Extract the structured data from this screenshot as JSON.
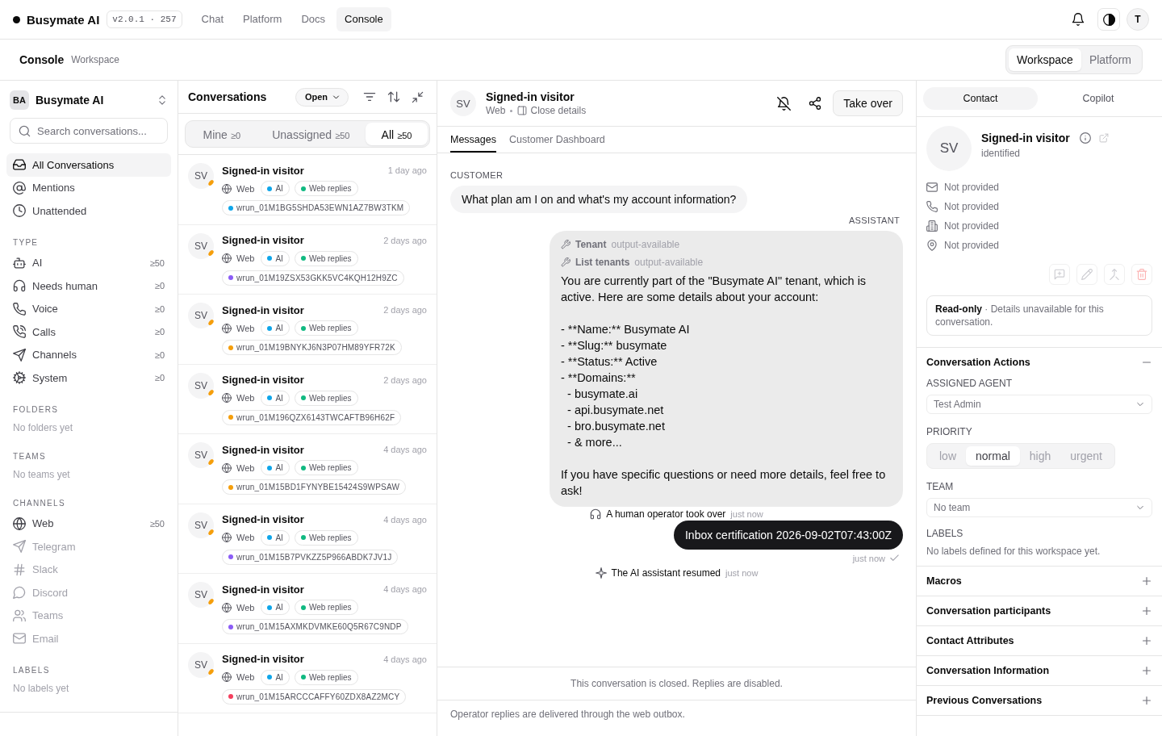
{
  "topbar": {
    "brand": "Busymate AI",
    "version": "v2.0.1 · 257",
    "nav": [
      {
        "label": "Chat",
        "selected": false
      },
      {
        "label": "Platform",
        "selected": false
      },
      {
        "label": "Docs",
        "selected": false
      },
      {
        "label": "Console",
        "selected": true
      }
    ],
    "avatar": "T"
  },
  "subheader": {
    "title": "Console",
    "subtitle": "Workspace",
    "scopes": [
      {
        "label": "Workspace",
        "selected": true
      },
      {
        "label": "Platform",
        "selected": false
      }
    ]
  },
  "sidebar": {
    "workspace": {
      "initials": "BA",
      "name": "Busymate AI"
    },
    "search": {
      "placeholder": "Search conversations..."
    },
    "views": [
      {
        "label": "All Conversations",
        "selected": true
      },
      {
        "label": "Mentions",
        "selected": false
      },
      {
        "label": "Unattended",
        "selected": false
      }
    ],
    "sections": [
      {
        "title": "TYPE",
        "items": [
          {
            "label": "AI",
            "count": "≥50"
          },
          {
            "label": "Needs human",
            "count": "≥0"
          },
          {
            "label": "Voice",
            "count": "≥0"
          },
          {
            "label": "Calls",
            "count": "≥0"
          },
          {
            "label": "Channels",
            "count": "≥0"
          },
          {
            "label": "System",
            "count": "≥0"
          }
        ]
      },
      {
        "title": "FOLDERS",
        "empty": "No folders yet"
      },
      {
        "title": "TEAMS",
        "empty": "No teams yet"
      },
      {
        "title": "CHANNELS",
        "items": [
          {
            "label": "Web",
            "count": "≥50",
            "disabled": false
          },
          {
            "label": "Telegram",
            "disabled": true
          },
          {
            "label": "Slack",
            "disabled": true
          },
          {
            "label": "Discord",
            "disabled": true
          },
          {
            "label": "Teams",
            "disabled": true
          },
          {
            "label": "Email",
            "disabled": true
          }
        ]
      },
      {
        "title": "LABELS",
        "empty": "No labels yet"
      }
    ]
  },
  "conversations": {
    "title": "Conversations",
    "status_filter": "Open",
    "tabs": [
      {
        "label": "Mine",
        "count": "≥0",
        "selected": false
      },
      {
        "label": "Unassigned",
        "count": "≥50",
        "selected": false
      },
      {
        "label": "All",
        "count": "≥50",
        "selected": true
      }
    ],
    "items": [
      {
        "initials": "SV",
        "name": "Signed-in visitor",
        "time": "1 day ago",
        "channel": "Web",
        "tags": [
          {
            "label": "AI",
            "color": "#0ea5e9"
          },
          {
            "label": "Web replies",
            "color": "#10b981"
          }
        ],
        "run": {
          "label": "wrun_01M1BG5SHDA53EWN1AZ7BW3TKM",
          "color": "#0ea5e9"
        }
      },
      {
        "initials": "SV",
        "name": "Signed-in visitor",
        "time": "2 days ago",
        "channel": "Web",
        "tags": [
          {
            "label": "AI",
            "color": "#0ea5e9"
          },
          {
            "label": "Web replies",
            "color": "#10b981"
          }
        ],
        "run": {
          "label": "wrun_01M19ZSX53GKK5VC4KQH12H9ZC",
          "color": "#8b5cf6"
        }
      },
      {
        "initials": "SV",
        "name": "Signed-in visitor",
        "time": "2 days ago",
        "channel": "Web",
        "tags": [
          {
            "label": "AI",
            "color": "#0ea5e9"
          },
          {
            "label": "Web replies",
            "color": "#10b981"
          }
        ],
        "run": {
          "label": "wrun_01M19BNYKJ6N3P07HM89YFR72K",
          "color": "#f59e0b"
        }
      },
      {
        "initials": "SV",
        "name": "Signed-in visitor",
        "time": "2 days ago",
        "channel": "Web",
        "tags": [
          {
            "label": "AI",
            "color": "#0ea5e9"
          },
          {
            "label": "Web replies",
            "color": "#10b981"
          }
        ],
        "run": {
          "label": "wrun_01M196QZX6143TWCAFTB96H62F",
          "color": "#f59e0b"
        }
      },
      {
        "initials": "SV",
        "name": "Signed-in visitor",
        "time": "4 days ago",
        "channel": "Web",
        "tags": [
          {
            "label": "AI",
            "color": "#0ea5e9"
          },
          {
            "label": "Web replies",
            "color": "#10b981"
          }
        ],
        "run": {
          "label": "wrun_01M15BD1FYNYBE15424S9WPSAW",
          "color": "#f59e0b"
        }
      },
      {
        "initials": "SV",
        "name": "Signed-in visitor",
        "time": "4 days ago",
        "channel": "Web",
        "tags": [
          {
            "label": "AI",
            "color": "#0ea5e9"
          },
          {
            "label": "Web replies",
            "color": "#10b981"
          }
        ],
        "run": {
          "label": "wrun_01M15B7PVKZZ5P966ABDK7JV1J",
          "color": "#8b5cf6"
        }
      },
      {
        "initials": "SV",
        "name": "Signed-in visitor",
        "time": "4 days ago",
        "channel": "Web",
        "tags": [
          {
            "label": "AI",
            "color": "#0ea5e9"
          },
          {
            "label": "Web replies",
            "color": "#10b981"
          }
        ],
        "run": {
          "label": "wrun_01M15AXMKDVMKE60Q5R67C9NDP",
          "color": "#8b5cf6"
        }
      },
      {
        "initials": "SV",
        "name": "Signed-in visitor",
        "time": "4 days ago",
        "channel": "Web",
        "tags": [
          {
            "label": "AI",
            "color": "#0ea5e9"
          },
          {
            "label": "Web replies",
            "color": "#10b981"
          }
        ],
        "run": {
          "label": "wrun_01M15ARCCCAFFY60ZDX8AZ2MCY",
          "color": "#f43f5e"
        }
      }
    ]
  },
  "chat": {
    "contact": {
      "initials": "SV",
      "name": "Signed-in visitor",
      "channel": "Web",
      "details_link": "Close details"
    },
    "action": "Take over",
    "tabs": [
      {
        "label": "Messages",
        "selected": true
      },
      {
        "label": "Customer Dashboard",
        "selected": false
      }
    ],
    "messages": [
      {
        "kind": "customer",
        "role": "CUSTOMER",
        "text": "What plan am I on and what's my account information?"
      },
      {
        "kind": "assistant",
        "role": "ASSISTANT",
        "tools": [
          {
            "name": "Tenant",
            "status": "output-available"
          },
          {
            "name": "List tenants",
            "status": "output-available"
          }
        ],
        "text": "You are currently part of the \"Busymate AI\" tenant, which is active. Here are some details about your account:\n\n- **Name:** Busymate AI\n- **Slug:** busymate\n- **Status:** Active\n- **Domains:**\n  - busymate.ai\n  - api.busymate.net\n  - bro.busymate.net\n  - & more...\n\nIf you have specific questions or need more details, feel free to ask!"
      },
      {
        "kind": "takeover",
        "text": "A human operator took over",
        "time": "just now"
      },
      {
        "kind": "operator",
        "text": "Inbox certification 2026-09-02T07:43:00Z",
        "time": "just now",
        "delivered": true
      },
      {
        "kind": "resume",
        "text": "The AI assistant resumed",
        "time": "just now"
      }
    ],
    "closed_notice": "This conversation is closed. Replies are disabled.",
    "footer": "Operator replies are delivered through the web outbox."
  },
  "details": {
    "tabs": [
      {
        "label": "Contact",
        "selected": true
      },
      {
        "label": "Copilot",
        "selected": false
      }
    ],
    "contact": {
      "initials": "SV",
      "name": "Signed-in visitor",
      "status": "identified",
      "fields": [
        "Not provided",
        "Not provided",
        "Not provided",
        "Not provided"
      ]
    },
    "notice": "**Read-only** · Details unavailable for this conversation.",
    "sections": [
      {
        "title": "Conversation Actions",
        "expanded": true,
        "assigned_agent": {
          "label": "ASSIGNED AGENT",
          "value": "Test Admin"
        },
        "priority": {
          "label": "PRIORITY",
          "options": [
            {
              "label": "low",
              "selected": false
            },
            {
              "label": "normal",
              "selected": true
            },
            {
              "label": "high",
              "selected": false
            },
            {
              "label": "urgent",
              "selected": false
            }
          ]
        },
        "team": {
          "label": "TEAM",
          "value": "No team"
        },
        "labels": {
          "label": "LABELS",
          "empty": "No labels defined for this workspace yet."
        }
      },
      {
        "title": "Macros",
        "expanded": false
      },
      {
        "title": "Conversation participants",
        "expanded": false
      },
      {
        "title": "Contact Attributes",
        "expanded": false
      },
      {
        "title": "Conversation Information",
        "expanded": false
      },
      {
        "title": "Previous Conversations",
        "expanded": false
      }
    ]
  }
}
